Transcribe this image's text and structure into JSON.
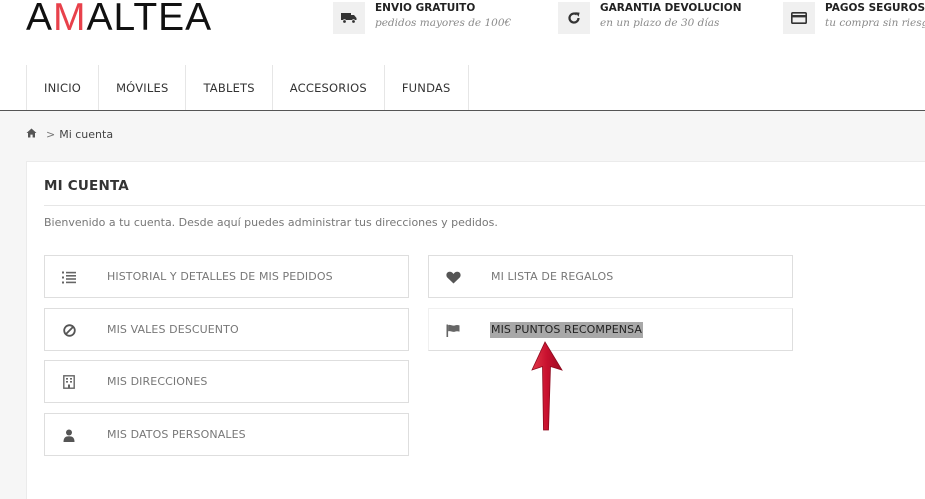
{
  "logo": {
    "prefix": "A",
    "accent": "M",
    "suffix": "ALTEA"
  },
  "features": [
    {
      "icon": "truck-icon",
      "title": "ENVIO GRATUITO",
      "subtitle": "pedidos mayores de 100€"
    },
    {
      "icon": "refresh-icon",
      "title": "GARANTIA DEVOLUCION",
      "subtitle": "en un plazo de 30 días"
    },
    {
      "icon": "credit-card-icon",
      "title": "PAGOS SEGUROS",
      "subtitle": "tu compra sin riesgo."
    }
  ],
  "nav": [
    "INICIO",
    "MÓVILES",
    "TABLETS",
    "ACCESORIOS",
    "FUNDAS"
  ],
  "breadcrumb": {
    "home_icon": "home-icon",
    "separator": ">",
    "current": "Mi cuenta"
  },
  "account": {
    "title": "MI CUENTA",
    "welcome": "Bienvenido a tu cuenta. Desde aquí puedes administrar tus direcciones y pedidos.",
    "left_items": [
      {
        "icon": "list-icon",
        "label": "HISTORIAL Y DETALLES DE MIS PEDIDOS"
      },
      {
        "icon": "ban-icon",
        "label": "MIS VALES DESCUENTO"
      },
      {
        "icon": "building-icon",
        "label": "MIS DIRECCIONES"
      },
      {
        "icon": "user-icon",
        "label": "MIS DATOS PERSONALES"
      }
    ],
    "right_items": [
      {
        "icon": "heart-icon",
        "label": "MI LISTA DE REGALOS"
      },
      {
        "icon": "flag-icon",
        "label": "MIS PUNTOS RECOMPENSA"
      }
    ]
  },
  "colors": {
    "accent": "#e8414b",
    "arrow": "#c8102e",
    "highlight": "#a8a8a8"
  }
}
